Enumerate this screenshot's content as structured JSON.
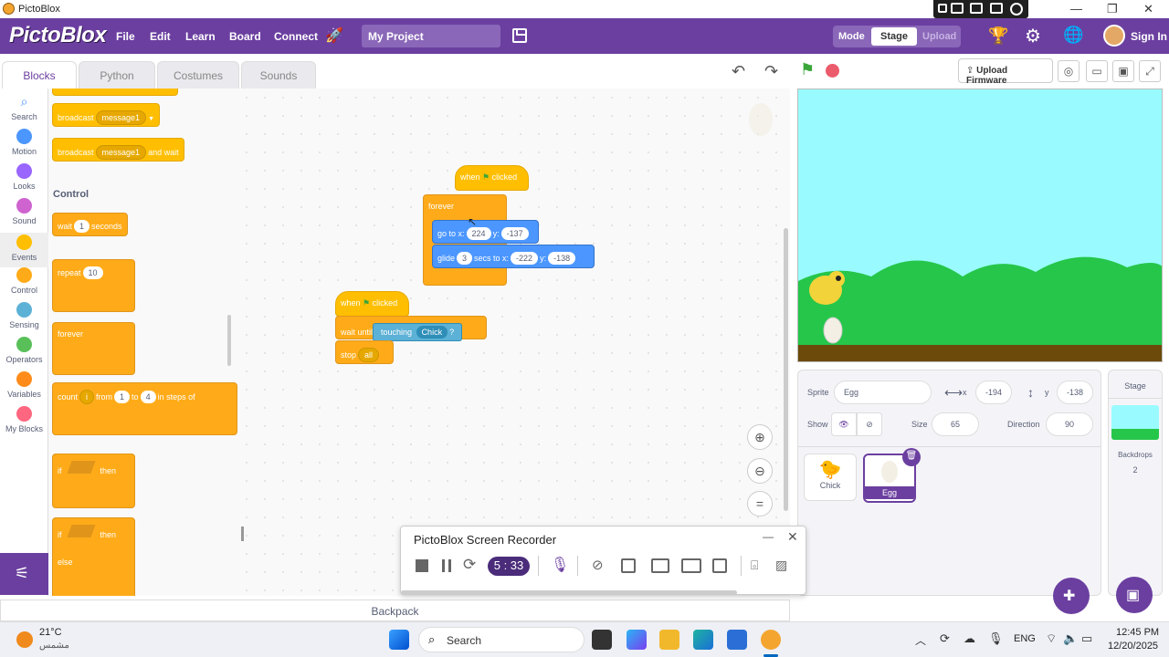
{
  "window": {
    "title": "PictoBlox",
    "minimize": "—",
    "maximize": "❐",
    "close": "✕"
  },
  "menubar": {
    "logo": "PictoBlox",
    "items": [
      "File",
      "Edit",
      "Learn",
      "Board",
      "Connect"
    ],
    "project_name": "My Project",
    "mode_label": "Mode",
    "mode_stage": "Stage",
    "mode_upload": "Upload",
    "sign_in": "Sign In"
  },
  "tabs": [
    "Blocks",
    "Python",
    "Costumes",
    "Sounds"
  ],
  "categories": [
    {
      "label": "Search",
      "color": "#4c97ff"
    },
    {
      "label": "Motion",
      "color": "#4c97ff"
    },
    {
      "label": "Looks",
      "color": "#9966ff"
    },
    {
      "label": "Sound",
      "color": "#cf63cf"
    },
    {
      "label": "Events",
      "color": "#ffbf00"
    },
    {
      "label": "Control",
      "color": "#ffab19"
    },
    {
      "label": "Sensing",
      "color": "#5cb1d6"
    },
    {
      "label": "Operators",
      "color": "#59c059"
    },
    {
      "label": "Variables",
      "color": "#ff8c1a"
    },
    {
      "label": "My Blocks",
      "color": "#ff6680"
    }
  ],
  "palette": {
    "broadcast": "broadcast",
    "message1": "message1",
    "and_wait": "and wait",
    "control_heading": "Control",
    "wait": "wait",
    "wait_val": "1",
    "seconds": "seconds",
    "repeat": "repeat",
    "repeat_val": "10",
    "forever": "forever",
    "count": "count",
    "count_var": "i",
    "from": "from",
    "from_val": "1",
    "to": "to",
    "to_val": "4",
    "in_steps_of": "in steps of",
    "if": "if",
    "then": "then",
    "else": "else"
  },
  "script1": {
    "when": "when",
    "clicked": "clicked",
    "forever": "forever",
    "goto": "go to x:",
    "goto_x": "224",
    "y_label": "y:",
    "goto_y": "-137",
    "glide": "glide",
    "glide_secs": "3",
    "secs_to_x": "secs to x:",
    "glide_x": "-222",
    "glide_y": "-138"
  },
  "script2": {
    "when": "when",
    "clicked": "clicked",
    "wait_until": "wait until",
    "touching": "touching",
    "touching_target": "Chick",
    "q": "?",
    "stop": "stop",
    "stop_opt": "all"
  },
  "toolbar": {
    "upload_firmware": "Upload Firmware"
  },
  "sprite_info": {
    "sprite_label": "Sprite",
    "sprite_name": "Egg",
    "x_label": "x",
    "x_val": "-194",
    "y_label": "y",
    "y_val": "-138",
    "show_label": "Show",
    "size_label": "Size",
    "size_val": "65",
    "direction_label": "Direction",
    "direction_val": "90"
  },
  "sprites": [
    {
      "name": "Chick",
      "selected": false
    },
    {
      "name": "Egg",
      "selected": true
    }
  ],
  "stage_panel": {
    "title": "Stage",
    "backdrops_label": "Backdrops",
    "backdrops_count": "2"
  },
  "backpack": "Backpack",
  "recorder": {
    "title": "PictoBlox Screen Recorder",
    "timer": "5 : 33",
    "minimize": "—",
    "close": "✕"
  },
  "taskbar": {
    "temp": "21°C",
    "weather": "مشمس",
    "search": "Search",
    "lang": "ENG",
    "time": "12:45 PM",
    "date": "12/20/2025"
  },
  "colors": {
    "brand": "#6b3fa0",
    "events": "#ffbf00",
    "control": "#ffab19",
    "motion": "#4c97ff",
    "sensing": "#5cb1d6"
  }
}
